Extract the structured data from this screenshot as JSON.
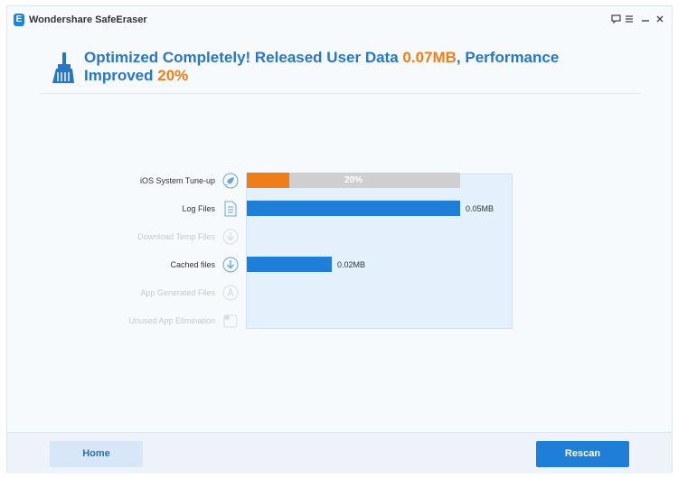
{
  "app": {
    "logo_letter": "E",
    "title": "Wondershare SafeEraser",
    "controls": [
      "feedback-icon",
      "menu-icon",
      "minimize-icon",
      "close-icon"
    ]
  },
  "headline": {
    "part1": "Optimized Completely!  Released User Data ",
    "released_value": "0.07MB",
    "part2": ", Performance Improved ",
    "improved_value": "20%"
  },
  "colors": {
    "accent_blue": "#1f7fd8",
    "highlight_orange": "#ef7d1a",
    "bar_gray": "#cfcfcf",
    "disabled_text": "#c4c9cf"
  },
  "rows": [
    {
      "label": "iOS System Tune-up",
      "icon": "rocket-icon",
      "enabled": true,
      "progress_percent": 20,
      "progress_label": "20%"
    },
    {
      "label": "Log Files",
      "icon": "document-icon",
      "enabled": true,
      "value_mb": 0.05,
      "value_label": "0.05MB"
    },
    {
      "label": "Download Temp Files",
      "icon": "download-icon",
      "enabled": false
    },
    {
      "label": "Cached files",
      "icon": "download-icon",
      "enabled": true,
      "value_mb": 0.02,
      "value_label": "0.02MB"
    },
    {
      "label": "App Generated Files",
      "icon": "app-store-icon",
      "enabled": false
    },
    {
      "label": "Unused App Elimination",
      "icon": "app-badge-icon",
      "enabled": false
    }
  ],
  "buttons": {
    "home_label": "Home",
    "rescan_label": "Rescan"
  }
}
